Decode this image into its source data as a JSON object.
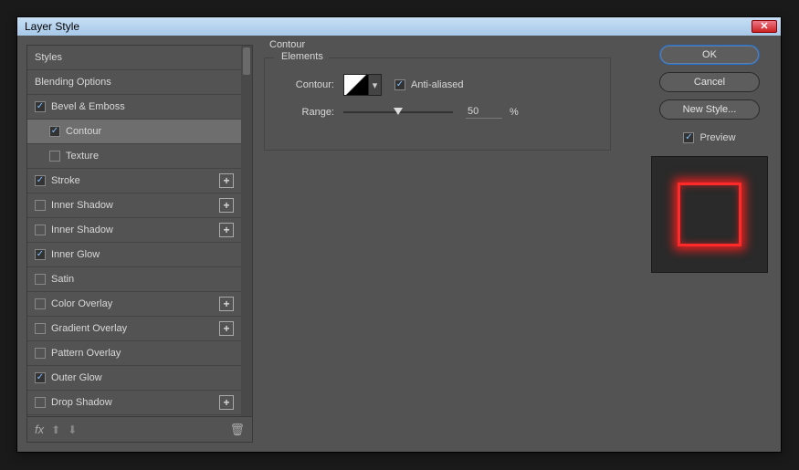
{
  "window": {
    "title": "Layer Style"
  },
  "sidebar": {
    "items": [
      {
        "label": "Styles",
        "checkbox": false
      },
      {
        "label": "Blending Options",
        "checkbox": false
      },
      {
        "label": "Bevel & Emboss",
        "checkbox": true,
        "checked": true
      },
      {
        "label": "Contour",
        "checkbox": true,
        "checked": true,
        "indent": true,
        "selected": true
      },
      {
        "label": "Texture",
        "checkbox": true,
        "checked": false,
        "indent": true
      },
      {
        "label": "Stroke",
        "checkbox": true,
        "checked": true,
        "plus": true
      },
      {
        "label": "Inner Shadow",
        "checkbox": true,
        "checked": false,
        "plus": true
      },
      {
        "label": "Inner Shadow",
        "checkbox": true,
        "checked": false,
        "plus": true
      },
      {
        "label": "Inner Glow",
        "checkbox": true,
        "checked": true
      },
      {
        "label": "Satin",
        "checkbox": true,
        "checked": false
      },
      {
        "label": "Color Overlay",
        "checkbox": true,
        "checked": false,
        "plus": true
      },
      {
        "label": "Gradient Overlay",
        "checkbox": true,
        "checked": false,
        "plus": true
      },
      {
        "label": "Pattern Overlay",
        "checkbox": true,
        "checked": false
      },
      {
        "label": "Outer Glow",
        "checkbox": true,
        "checked": true
      },
      {
        "label": "Drop Shadow",
        "checkbox": true,
        "checked": false,
        "plus": true
      }
    ],
    "fx_label": "fx"
  },
  "center": {
    "heading": "Contour",
    "group_label": "Elements",
    "contour_label": "Contour:",
    "anti_aliased_label": "Anti-aliased",
    "anti_aliased_checked": true,
    "range_label": "Range:",
    "range_value": "50",
    "range_unit": "%"
  },
  "right": {
    "ok": "OK",
    "cancel": "Cancel",
    "new_style": "New Style...",
    "preview_label": "Preview",
    "preview_checked": true
  }
}
